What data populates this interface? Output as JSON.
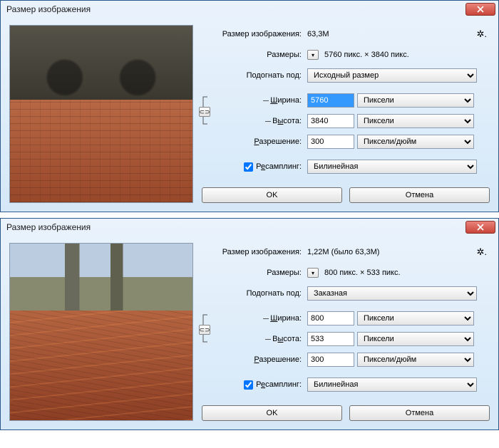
{
  "dialogs": [
    {
      "title": "Размер изображения",
      "size": {
        "label": "Размер изображения:",
        "value": "63,3M"
      },
      "dims": {
        "label": "Размеры:",
        "value": "5760 пикс.  ×  3840 пикс."
      },
      "fit": {
        "label": "Подогнать под:",
        "value": "Исходный размер"
      },
      "width": {
        "label": "Ширина:",
        "value": "5760",
        "unit": "Пиксели",
        "selected": true
      },
      "height": {
        "label": "Высота:",
        "value": "3840",
        "unit": "Пиксели"
      },
      "res": {
        "label": "Разрешение:",
        "value": "300",
        "unit": "Пиксели/дюйм"
      },
      "resample": {
        "label": "Ресамплинг:",
        "checked": true,
        "method": "Билинейная",
        "prefix": "Р",
        "ulChar": "е",
        "suffix": "самплинг:"
      },
      "ok": "OK",
      "cancel": "Отмена",
      "widthUL": {
        "prefix": "",
        "ulChar": "Ш",
        "suffix": "ирина:"
      },
      "heightUL": {
        "prefix": "В",
        "ulChar": "ы",
        "suffix": "сота:"
      },
      "resUL": {
        "prefix": "",
        "ulChar": "Р",
        "suffix": "азрешение:"
      }
    },
    {
      "title": "Размер изображения",
      "size": {
        "label": "Размер изображения:",
        "value": "1,22M (было 63,3M)"
      },
      "dims": {
        "label": "Размеры:",
        "value": "800 пикс.  ×  533 пикс."
      },
      "fit": {
        "label": "Подогнать под:",
        "value": "Заказная"
      },
      "width": {
        "label": "Ширина:",
        "value": "800",
        "unit": "Пиксели",
        "selected": false
      },
      "height": {
        "label": "Высота:",
        "value": "533",
        "unit": "Пиксели"
      },
      "res": {
        "label": "Разрешение:",
        "value": "300",
        "unit": "Пиксели/дюйм"
      },
      "resample": {
        "label": "Ресамплинг:",
        "checked": true,
        "method": "Билинейная",
        "prefix": "Р",
        "ulChar": "е",
        "suffix": "самплинг:"
      },
      "ok": "OK",
      "cancel": "Отмена",
      "widthUL": {
        "prefix": "",
        "ulChar": "Ш",
        "suffix": "ирина:"
      },
      "heightUL": {
        "prefix": "В",
        "ulChar": "ы",
        "suffix": "сота:"
      },
      "resUL": {
        "prefix": "",
        "ulChar": "Р",
        "suffix": "азрешение:"
      }
    }
  ]
}
